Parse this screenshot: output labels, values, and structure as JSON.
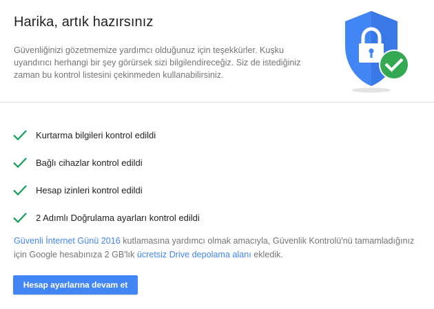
{
  "header": {
    "title": "Harika, artık hazırsınız",
    "intro": "Güvenliğinizi gözetmemize yardımcı olduğunuz için teşekkürler. Kuşku uyandırıcı herhangi bir şey görürsek sizi bilgilendireceğiz. Siz de istediğiniz zaman bu kontrol listesini çekinmeden kullanabilirsiniz.",
    "illustration_icon": "shield-lock-check-icon"
  },
  "checklist": [
    {
      "label": "Kurtarma bilgileri kontrol edildi",
      "icon": "checkmark-icon"
    },
    {
      "label": "Bağlı cihazlar kontrol edildi",
      "icon": "checkmark-icon"
    },
    {
      "label": "Hesap izinleri kontrol edildi",
      "icon": "checkmark-icon"
    },
    {
      "label": "2 Adımlı Doğrulama ayarları kontrol edildi",
      "icon": "checkmark-icon"
    }
  ],
  "info": {
    "link1": "Güvenli İnternet Günü 2016",
    "text1": " kutlamasına yardımcı olmak amacıyla, Güvenlik Kontrolü'nü tamamladığınız için Google hesabınıza 2 GB'lık ",
    "link2": "ücretsiz Drive depolama alanı",
    "text2": " ekledik."
  },
  "cta": {
    "label": "Hesap ayarlarına devam et"
  },
  "colors": {
    "accent": "#4285f4",
    "check": "#0f9d58",
    "shield": "#4285f4",
    "badge": "#34a853"
  }
}
